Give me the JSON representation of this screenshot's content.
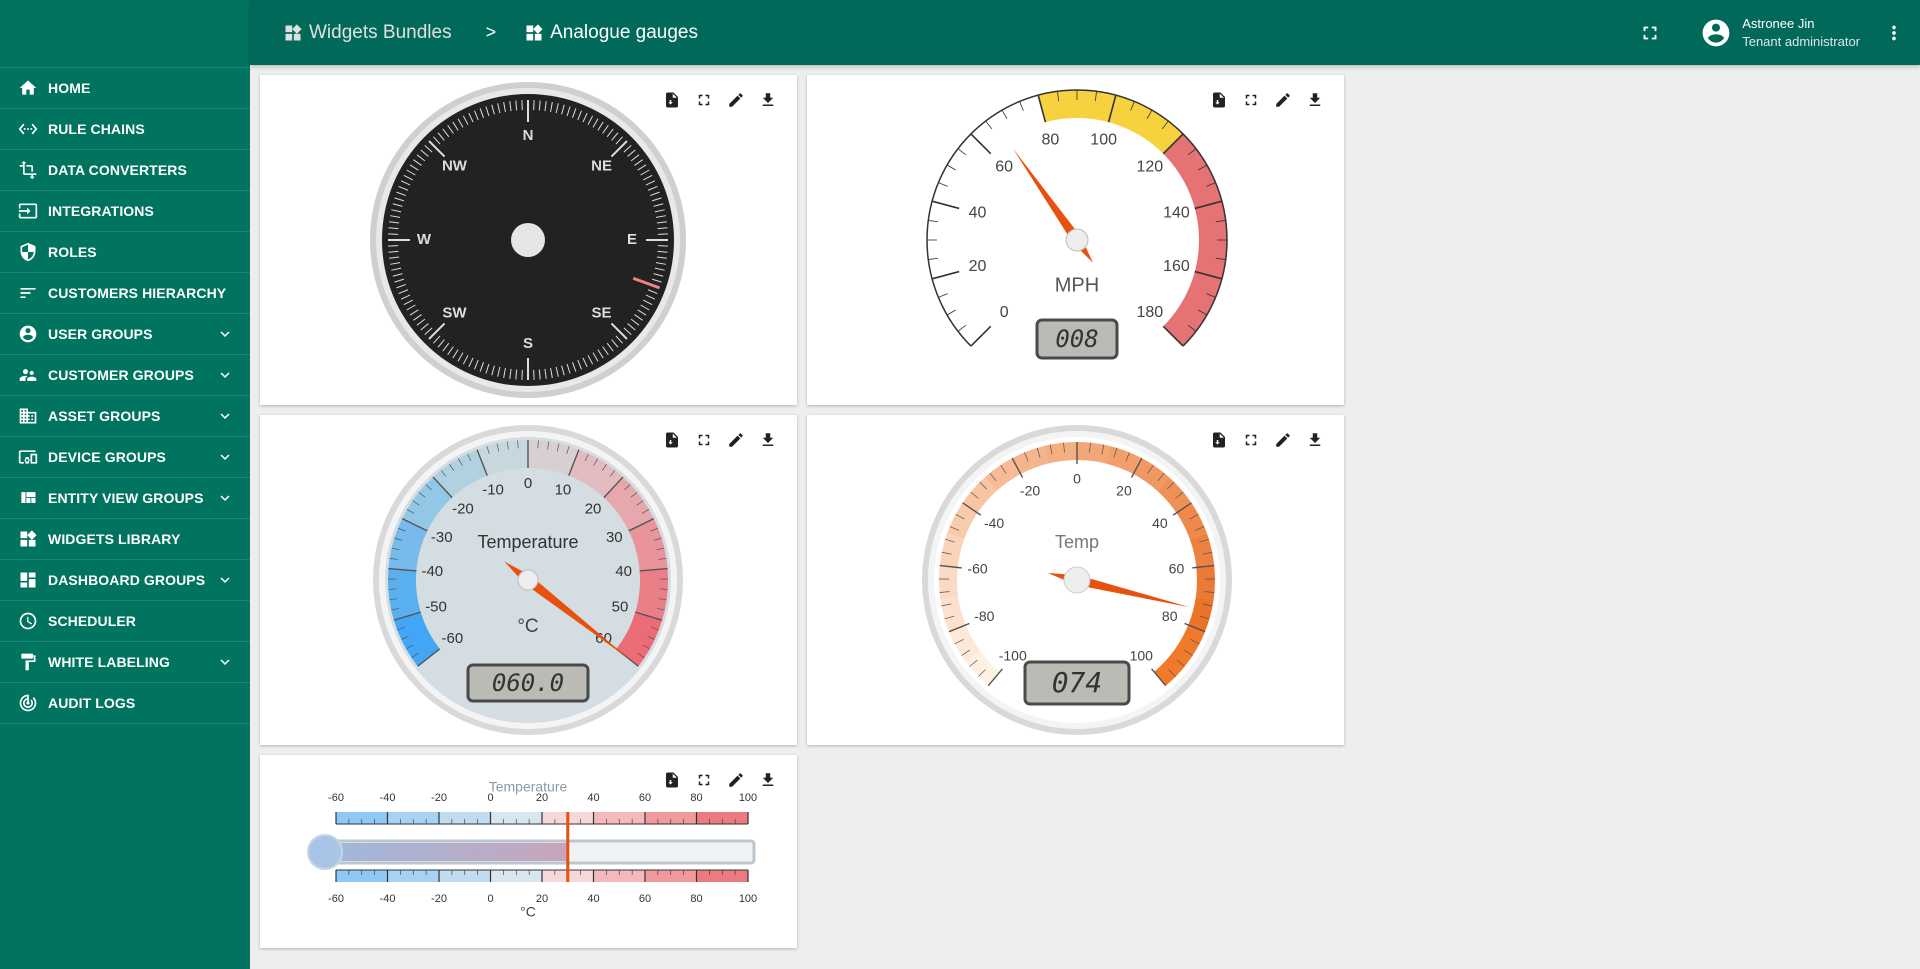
{
  "sidebar": {
    "items": [
      {
        "label": "HOME",
        "icon": "home-icon",
        "expandable": false
      },
      {
        "label": "RULE CHAINS",
        "icon": "settings-ethernet-icon",
        "expandable": false
      },
      {
        "label": "DATA CONVERTERS",
        "icon": "transform-icon",
        "expandable": false
      },
      {
        "label": "INTEGRATIONS",
        "icon": "input-icon",
        "expandable": false
      },
      {
        "label": "ROLES",
        "icon": "security-shield-icon",
        "expandable": false
      },
      {
        "label": "CUSTOMERS HIERARCHY",
        "icon": "sort-icon",
        "expandable": false
      },
      {
        "label": "USER GROUPS",
        "icon": "account-circle-icon",
        "expandable": true
      },
      {
        "label": "CUSTOMER GROUPS",
        "icon": "supervisor-account-icon",
        "expandable": true
      },
      {
        "label": "ASSET GROUPS",
        "icon": "domain-icon",
        "expandable": true
      },
      {
        "label": "DEVICE GROUPS",
        "icon": "devices-other-icon",
        "expandable": true
      },
      {
        "label": "ENTITY VIEW GROUPS",
        "icon": "view-quilt-icon",
        "expandable": true
      },
      {
        "label": "WIDGETS LIBRARY",
        "icon": "widgets-icon",
        "expandable": false
      },
      {
        "label": "DASHBOARD GROUPS",
        "icon": "dashboard-icon",
        "expandable": true
      },
      {
        "label": "SCHEDULER",
        "icon": "schedule-icon",
        "expandable": false
      },
      {
        "label": "WHITE LABELING",
        "icon": "format-paint-icon",
        "expandable": true
      },
      {
        "label": "AUDIT LOGS",
        "icon": "track-changes-icon",
        "expandable": false
      }
    ]
  },
  "header": {
    "breadcrumb": [
      {
        "label": "Widgets Bundles",
        "icon": "widgets-icon"
      },
      {
        "label": "Analogue gauges",
        "icon": "widgets-icon"
      }
    ],
    "separator": ">",
    "user": {
      "name": "Astronee Jin",
      "role": "Tenant administrator"
    }
  },
  "widgets": {
    "compass": {
      "cardinals": [
        "N",
        "NE",
        "E",
        "SE",
        "S",
        "SW",
        "W",
        "NW"
      ],
      "heading_deg": 110
    },
    "speedometer": {
      "ticks": [
        "0",
        "20",
        "40",
        "60",
        "80",
        "100",
        "120",
        "140",
        "160",
        "180"
      ],
      "unit": "MPH",
      "value": 8,
      "display": "008",
      "min": 0,
      "max": 180
    },
    "temp_gauge": {
      "title": "Temperature",
      "unit": "°C",
      "ticks": [
        "-60",
        "-50",
        "-40",
        "-30",
        "-20",
        "-10",
        "0",
        "10",
        "20",
        "30",
        "40",
        "50",
        "60"
      ],
      "value": 60,
      "display": "060.0",
      "min": -60,
      "max": 60
    },
    "temp_gauge2": {
      "title": "Temp",
      "ticks": [
        "-100",
        "-80",
        "-60",
        "-40",
        "-20",
        "0",
        "20",
        "40",
        "60",
        "80",
        "100"
      ],
      "value": 74,
      "display": "074",
      "min": -100,
      "max": 100
    },
    "thermometer": {
      "title": "Temperature",
      "unit": "°C",
      "ticks": [
        "-60",
        "-40",
        "-20",
        "0",
        "20",
        "40",
        "60",
        "80",
        "100"
      ],
      "value": 30,
      "min": -60,
      "max": 100
    }
  },
  "colors": {
    "sidebar_bg": "#00745e",
    "header_bg": "#00695a",
    "needle": "#e8500e",
    "speed_yellow": "#f7d23f",
    "speed_red": "#e57373",
    "cold_blue": "#42a5f5",
    "hot_orange": "#f07a2a"
  }
}
